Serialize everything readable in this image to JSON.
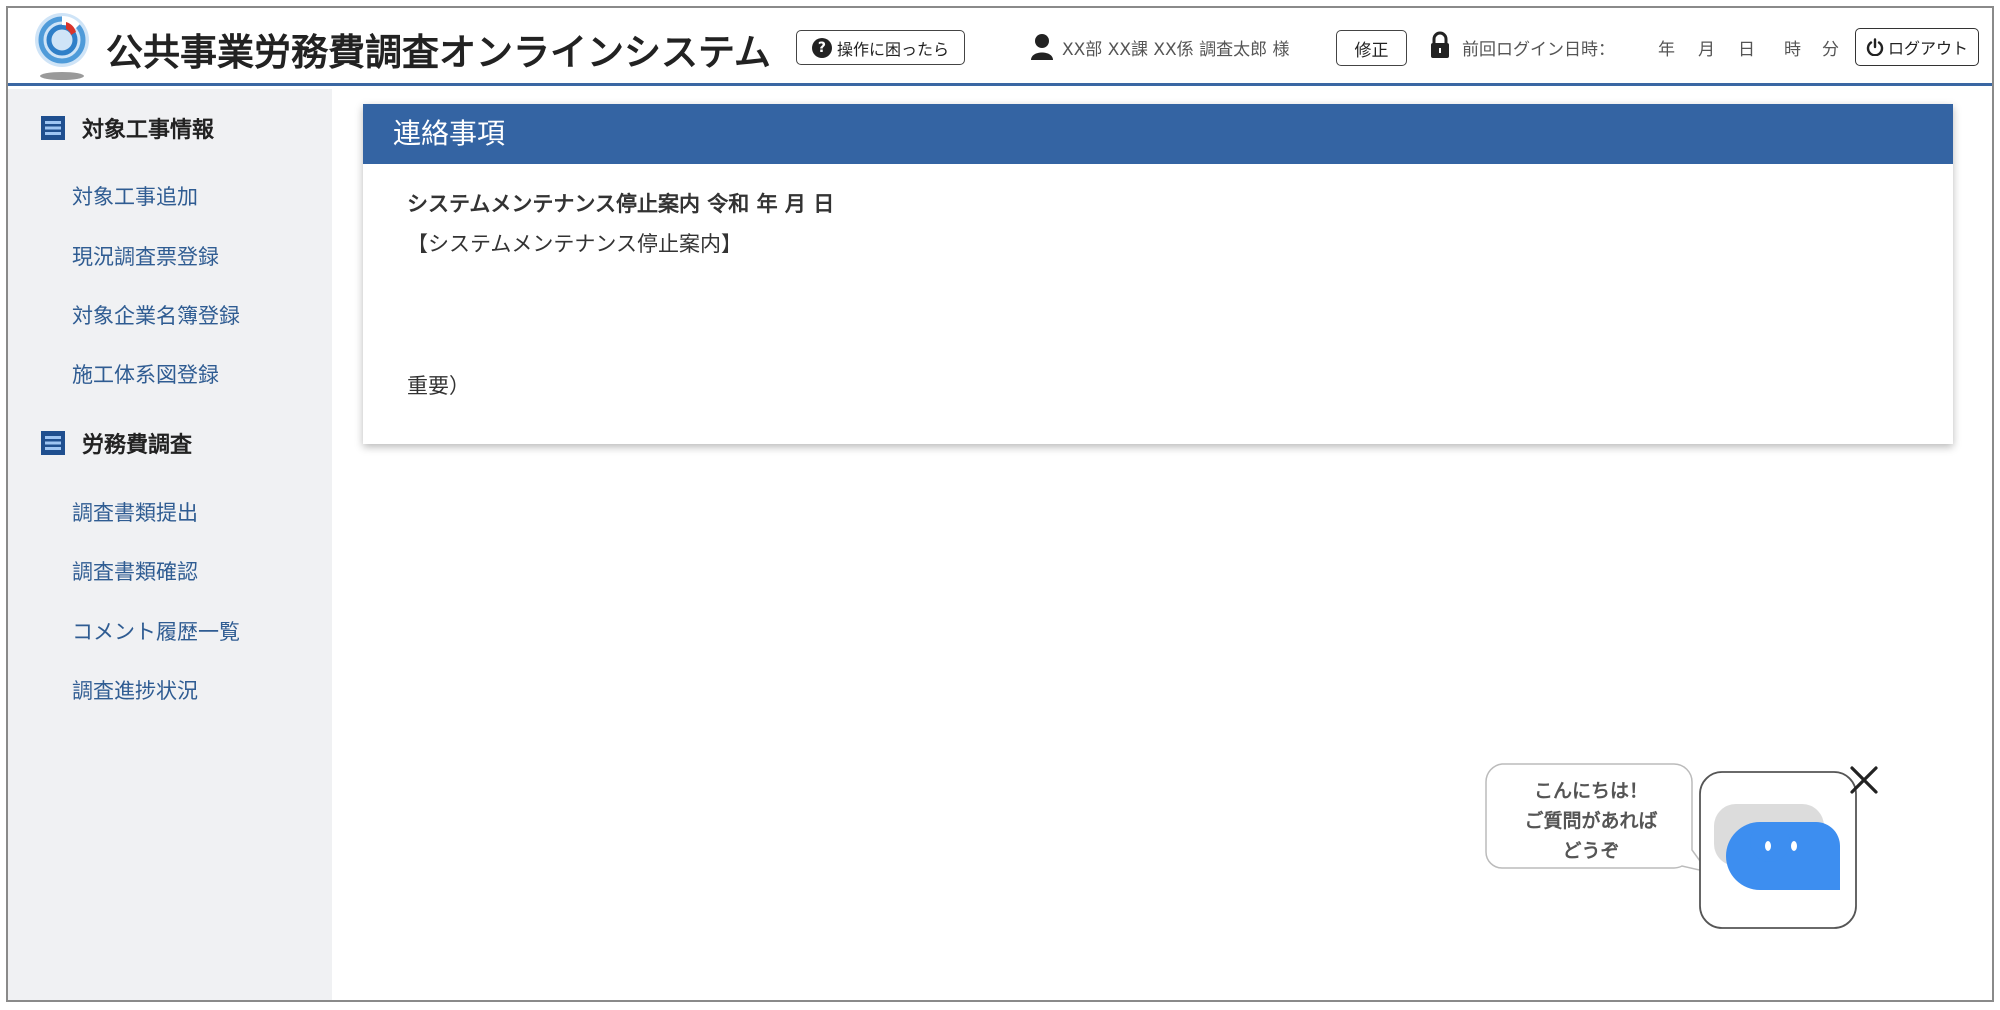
{
  "header": {
    "app_title": "公共事業労務費調査オンラインシステム",
    "help_label": "操作に困ったら",
    "user_info": "XX部  XX課  XX係  調査太郎  様",
    "edit_label": "修正",
    "last_login_label": "前回ログイン日時：",
    "date_units": {
      "year": "年",
      "month": "月",
      "day": "日",
      "hour": "時",
      "minute": "分"
    },
    "logout_label": "ログアウト"
  },
  "sidebar": {
    "sections": [
      {
        "title": "対象工事情報",
        "items": [
          "対象工事追加",
          "現況調査票登録",
          "対象企業名簿登録",
          "施工体系図登録"
        ]
      },
      {
        "title": "労務費調査",
        "items": [
          "調査書類提出",
          "調査書類確認",
          "コメント履歴一覧",
          "調査進捗状況"
        ]
      }
    ]
  },
  "notice": {
    "heading": "連絡事項",
    "title": "システムメンテナンス停止案内  令和   年   月   日",
    "subtitle": "【システムメンテナンス停止案内】",
    "important": "重要）"
  },
  "chatbot": {
    "line1": "こんにちは！",
    "line2": "ご質問があれば",
    "line3": "どうぞ"
  },
  "colors": {
    "accent": "#3464a3",
    "sidebar_bg": "#f0f1f3",
    "link": "#2f5c92",
    "bot_blue": "#3d8ef0"
  },
  "icons": {
    "logo": "mlit-logo-icon",
    "help": "question-circle-icon",
    "user": "user-icon",
    "lock": "lock-icon",
    "logout": "power-icon",
    "section": "list-icon",
    "close": "close-icon",
    "chatbot": "chatbot-icon"
  }
}
